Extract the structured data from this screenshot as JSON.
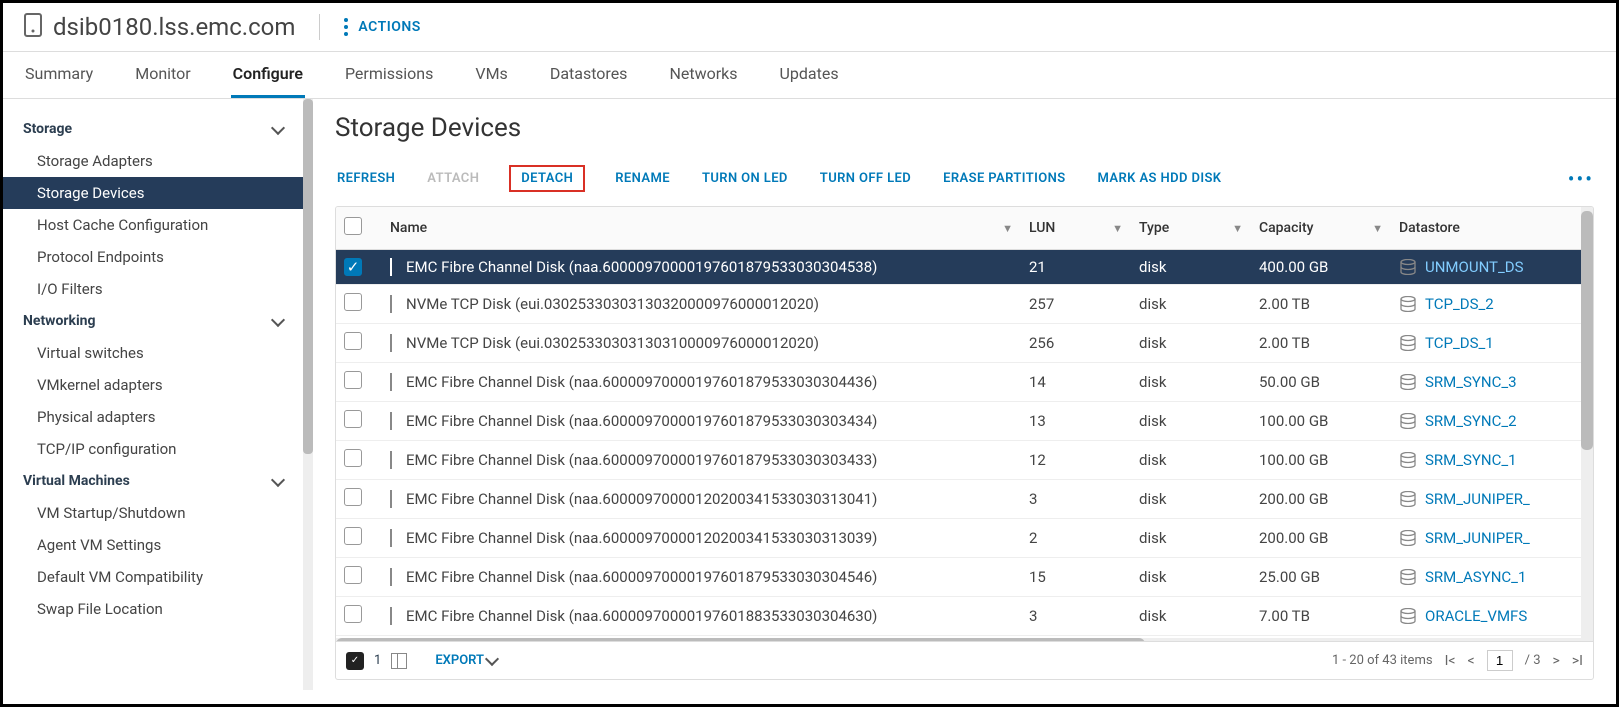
{
  "header": {
    "host_title": "dsib0180.lss.emc.com",
    "actions_label": "ACTIONS"
  },
  "tabs": [
    {
      "id": "summary",
      "label": "Summary"
    },
    {
      "id": "monitor",
      "label": "Monitor"
    },
    {
      "id": "configure",
      "label": "Configure",
      "active": true
    },
    {
      "id": "permissions",
      "label": "Permissions"
    },
    {
      "id": "vms",
      "label": "VMs"
    },
    {
      "id": "datastores",
      "label": "Datastores"
    },
    {
      "id": "networks",
      "label": "Networks"
    },
    {
      "id": "updates",
      "label": "Updates"
    }
  ],
  "sidebar": [
    {
      "group": "Storage",
      "expanded": true,
      "items": [
        {
          "label": "Storage Adapters"
        },
        {
          "label": "Storage Devices",
          "active": true
        },
        {
          "label": "Host Cache Configuration"
        },
        {
          "label": "Protocol Endpoints"
        },
        {
          "label": "I/O Filters"
        }
      ]
    },
    {
      "group": "Networking",
      "expanded": true,
      "items": [
        {
          "label": "Virtual switches"
        },
        {
          "label": "VMkernel adapters"
        },
        {
          "label": "Physical adapters"
        },
        {
          "label": "TCP/IP configuration"
        }
      ]
    },
    {
      "group": "Virtual Machines",
      "expanded": true,
      "items": [
        {
          "label": "VM Startup/Shutdown"
        },
        {
          "label": "Agent VM Settings"
        },
        {
          "label": "Default VM Compatibility"
        },
        {
          "label": "Swap File Location"
        }
      ]
    }
  ],
  "page": {
    "title": "Storage Devices"
  },
  "toolbar": {
    "refresh": "REFRESH",
    "attach": "ATTACH",
    "detach": "DETACH",
    "rename": "RENAME",
    "turn_on_led": "TURN ON LED",
    "turn_off_led": "TURN OFF LED",
    "erase": "ERASE PARTITIONS",
    "mark_hdd": "MARK AS HDD DISK",
    "more": "•••"
  },
  "columns": {
    "name": "Name",
    "lun": "LUN",
    "type": "Type",
    "capacity": "Capacity",
    "datastore": "Datastore"
  },
  "rows": [
    {
      "selected": true,
      "name": "EMC Fibre Channel Disk (naa.60000970000197601879533030304538)",
      "lun": "21",
      "type": "disk",
      "capacity": "400.00 GB",
      "datastore": "UNMOUNT_DS"
    },
    {
      "selected": false,
      "name": "NVMe TCP Disk (eui.03025330303130320000976000012020)",
      "lun": "257",
      "type": "disk",
      "capacity": "2.00 TB",
      "datastore": "TCP_DS_2"
    },
    {
      "selected": false,
      "name": "NVMe TCP Disk (eui.03025330303130310000976000012020)",
      "lun": "256",
      "type": "disk",
      "capacity": "2.00 TB",
      "datastore": "TCP_DS_1"
    },
    {
      "selected": false,
      "name": "EMC Fibre Channel Disk (naa.60000970000197601879533030304436)",
      "lun": "14",
      "type": "disk",
      "capacity": "50.00 GB",
      "datastore": "SRM_SYNC_3"
    },
    {
      "selected": false,
      "name": "EMC Fibre Channel Disk (naa.60000970000197601879533030303434)",
      "lun": "13",
      "type": "disk",
      "capacity": "100.00 GB",
      "datastore": "SRM_SYNC_2"
    },
    {
      "selected": false,
      "name": "EMC Fibre Channel Disk (naa.60000970000197601879533030303433)",
      "lun": "12",
      "type": "disk",
      "capacity": "100.00 GB",
      "datastore": "SRM_SYNC_1"
    },
    {
      "selected": false,
      "name": "EMC Fibre Channel Disk (naa.60000970000120200341533030313041)",
      "lun": "3",
      "type": "disk",
      "capacity": "200.00 GB",
      "datastore": "SRM_JUNIPER_"
    },
    {
      "selected": false,
      "name": "EMC Fibre Channel Disk (naa.60000970000120200341533030313039)",
      "lun": "2",
      "type": "disk",
      "capacity": "200.00 GB",
      "datastore": "SRM_JUNIPER_"
    },
    {
      "selected": false,
      "name": "EMC Fibre Channel Disk (naa.60000970000197601879533030304546)",
      "lun": "15",
      "type": "disk",
      "capacity": "25.00 GB",
      "datastore": "SRM_ASYNC_1"
    },
    {
      "selected": false,
      "name": "EMC Fibre Channel Disk (naa.60000970000197601883533030304630)",
      "lun": "3",
      "type": "disk",
      "capacity": "7.00 TB",
      "datastore": "ORACLE_VMFS"
    }
  ],
  "footer": {
    "selected_count": "1",
    "export": "EXPORT",
    "page_summary": "1 - 20 of 43 items",
    "current_page": "1",
    "total_pages": "3"
  }
}
